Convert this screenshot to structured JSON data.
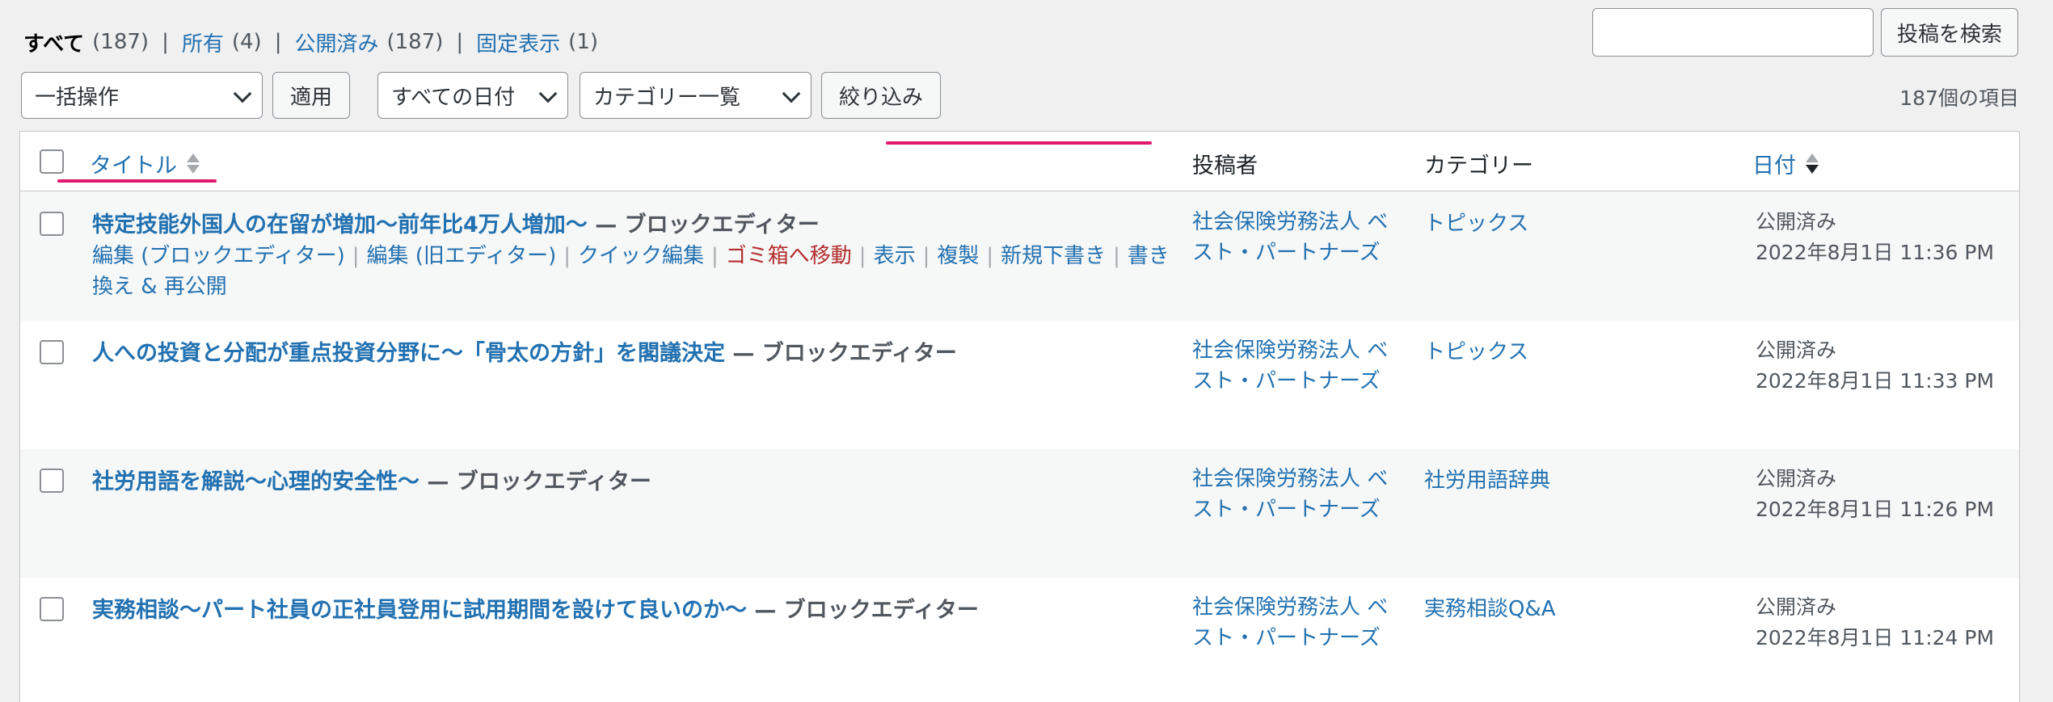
{
  "status_links": [
    {
      "label": "すべて",
      "count": "(187)"
    },
    {
      "label": "所有",
      "count": "(4)"
    },
    {
      "label": "公開済み",
      "count": "(187)"
    },
    {
      "label": "固定表示",
      "count": "(1)"
    }
  ],
  "status_separator": "|",
  "search": {
    "value": "",
    "button": "投稿を検索"
  },
  "toolbar": {
    "bulk_action": "一括操作",
    "apply": "適用",
    "date_filter": "すべての日付",
    "category_filter": "カテゴリー一覧",
    "filter_button": "絞り込み",
    "items_count": "187個の項目"
  },
  "table": {
    "columns": {
      "title": "タイトル",
      "author": "投稿者",
      "categories": "カテゴリー",
      "date": "日付"
    },
    "row_actions": {
      "edit_block": "編集 (ブロックエディター)",
      "edit_classic": "編集 (旧エディター)",
      "quick_edit": "クイック編集",
      "trash": "ゴミ箱へ移動",
      "view": "表示",
      "duplicate": "複製",
      "new_draft": "新規下書き",
      "rewrite": "書き換え & 再公開",
      "sep": "|"
    },
    "rows": [
      {
        "title": "特定技能外国人の在留が増加〜前年比4万人増加〜",
        "state": " — ブロックエディター",
        "author": "社会保険労務法人 ベスト・パートナーズ",
        "category": "トピックス",
        "status": "公開済み",
        "date": "2022年8月1日 11:36 PM"
      },
      {
        "title": "人への投資と分配が重点投資分野に〜「骨太の方針」を閣議決定",
        "state": " — ブロックエディター",
        "author": "社会保険労務法人 ベスト・パートナーズ",
        "category": "トピックス",
        "status": "公開済み",
        "date": "2022年8月1日 11:33 PM"
      },
      {
        "title": "社労用語を解説〜心理的安全性〜",
        "state": " — ブロックエディター",
        "author": "社会保険労務法人 ベスト・パートナーズ",
        "category": "社労用語辞典",
        "status": "公開済み",
        "date": "2022年8月1日 11:26 PM"
      },
      {
        "title": "実務相談〜パート社員の正社員登用に試用期間を設けて良いのか〜",
        "state": " — ブロックエディター",
        "author": "社会保険労務法人 ベスト・パートナーズ",
        "category": "実務相談Q&A",
        "status": "公開済み",
        "date": "2022年8月1日 11:24 PM"
      }
    ]
  },
  "colors": {
    "link": "#2271b1",
    "trash": "#b32d2e",
    "highlight_underline": "#e0196c"
  }
}
